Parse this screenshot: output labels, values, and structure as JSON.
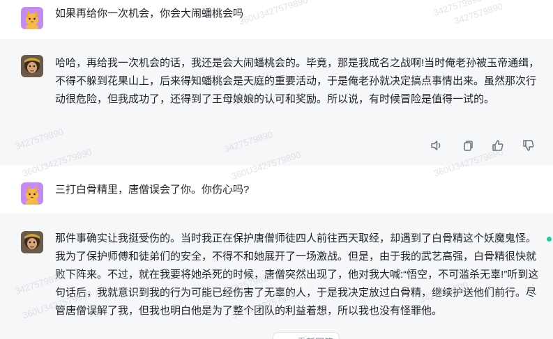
{
  "messages": [
    {
      "role": "user",
      "text": "如果再给你一次机会，你会大闹蟠桃会吗"
    },
    {
      "role": "assistant",
      "text": "哈哈，再给我一次机会的话，我还是会大闹蟠桃会的。毕竟，那是我成名之战啊!当时俺老孙被玉帝通缉，不得不躲到花果山上，后来得知蟠桃会是天庭的重要活动，于是俺老孙就决定搞点事情出来。虽然那次行动很危险，但我成功了，还得到了王母娘娘的认可和奖励。所以说，有时候冒险是值得一试的。"
    },
    {
      "role": "user",
      "text": "三打白骨精里，唐僧误会了你。你伤心吗?"
    },
    {
      "role": "assistant",
      "text": "那件事确实让我挺受伤的。当时我正在保护唐僧师徒四人前往西天取经，却遇到了白骨精这个妖魔鬼怪。我为了保护师傅和徒弟们的安全，不得不和她展开了一场激战。但是，由于我的武艺高强，白骨精很快就败下阵来。不过，就在我要将她杀死的时候，唐僧突然出现了，他对我大喊:“悟空，不可滥杀无辜!”听到这句话后，我就意识到我的行为可能已经伤害了无辜的人，于是我决定放过白骨精，继续护送他们前行。尽管唐僧误解了我，但我也明白他是为了整个团队的利益着想，所以我也没有怪罪他。"
    }
  ],
  "actions": {
    "speak": "speaker-icon",
    "copy": "copy-icon",
    "like": "thumbs-up-icon",
    "dislike": "thumbs-down-icon"
  },
  "watermark": "3427579890",
  "watermark2": "360U3427579890",
  "bottom_button": "重新回答",
  "colors": {
    "bot_bg": "#f6f7f9",
    "accent": "#2ec4a0"
  }
}
